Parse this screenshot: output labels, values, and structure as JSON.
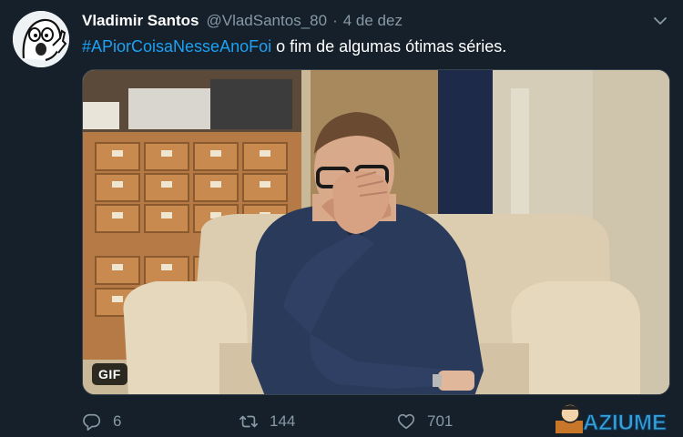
{
  "tweet": {
    "display_name": "Vladimir Santos",
    "handle": "@VladSantos_80",
    "separator": "·",
    "date": "4 de dez",
    "hashtag": "#APiorCoisaNesseAnoFoi",
    "text": " o fim de algumas ótimas séries.",
    "media": {
      "badge": "GIF"
    },
    "actions": {
      "replies": "6",
      "retweets": "144",
      "likes": "701"
    }
  },
  "watermark": {
    "brand": "AZIUME"
  },
  "colors": {
    "background": "#15202b",
    "secondary_text": "#8899a6",
    "hashtag": "#1da1f2",
    "brand": "#3aa0d8"
  },
  "icons": {
    "caret": "chevron-down-icon",
    "reply": "reply-icon",
    "retweet": "retweet-icon",
    "like": "heart-icon"
  }
}
